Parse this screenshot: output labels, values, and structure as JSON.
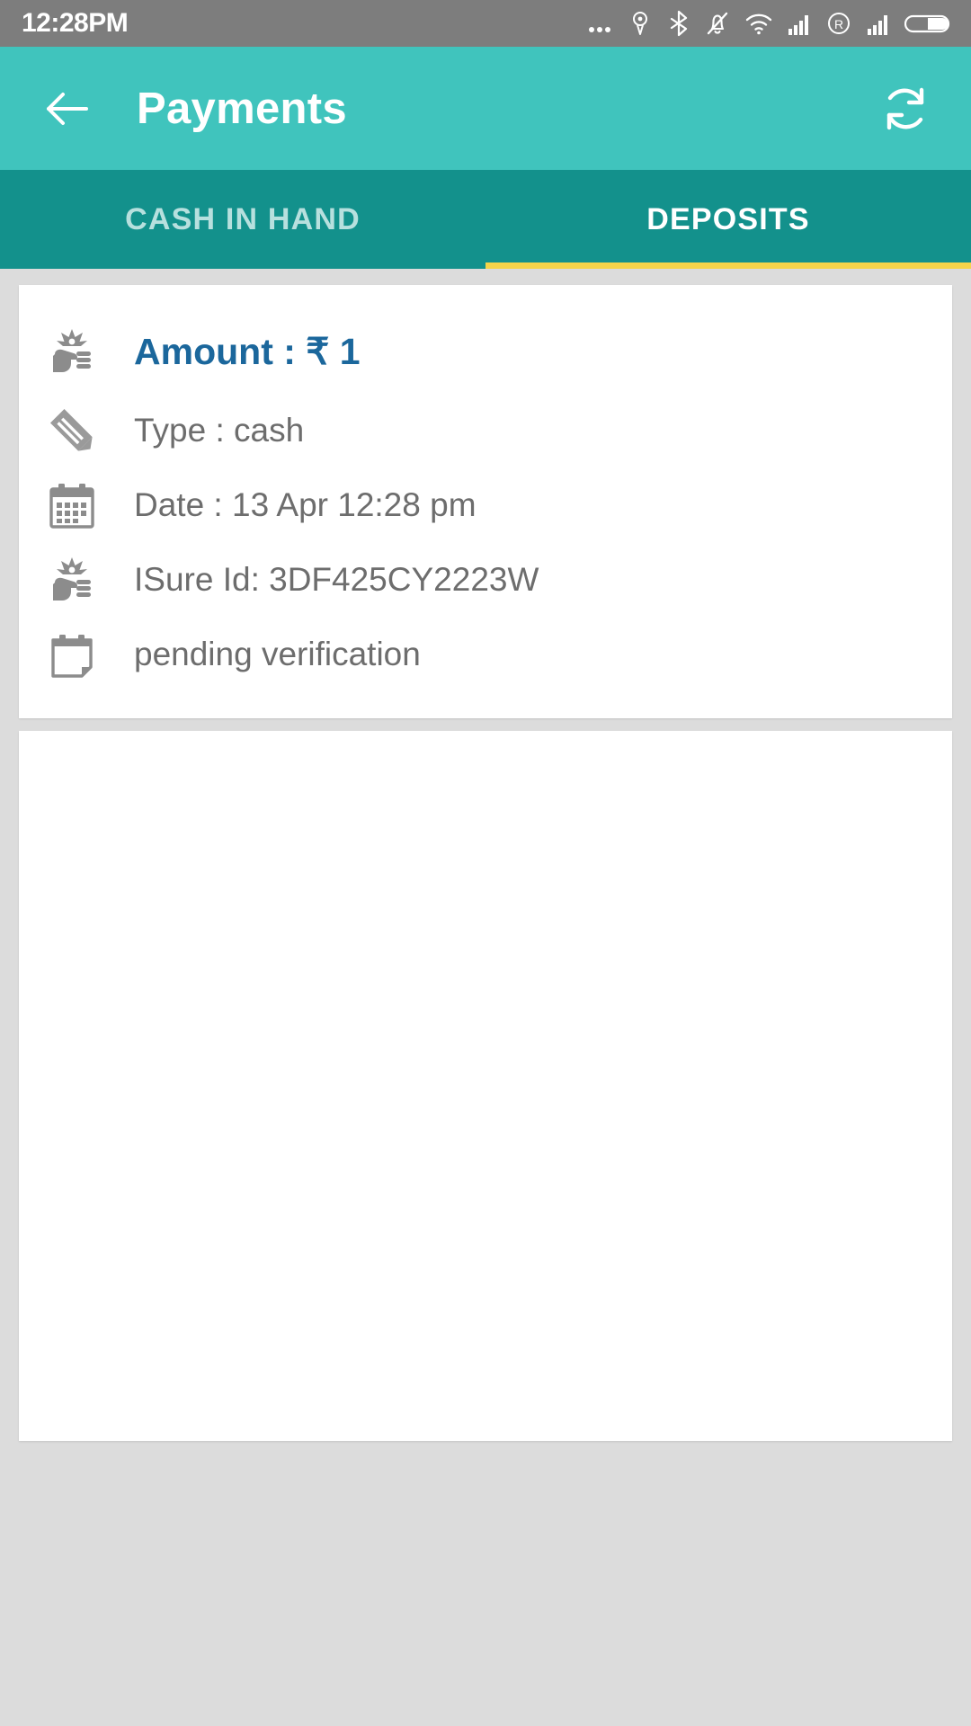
{
  "status_bar": {
    "time": "12:28PM",
    "icons": [
      {
        "name": "more-dots-icon"
      },
      {
        "name": "cast-icon"
      },
      {
        "name": "bluetooth-icon"
      },
      {
        "name": "mute-vibrate-icon"
      },
      {
        "name": "wifi-icon"
      },
      {
        "name": "signal-bars-icon"
      },
      {
        "name": "roaming-icon"
      },
      {
        "name": "signal-bars-2-icon"
      },
      {
        "name": "battery-icon"
      }
    ]
  },
  "app_bar": {
    "back_label": "back-arrow",
    "title": "Payments",
    "refresh_label": "refresh"
  },
  "tabs": {
    "items": [
      {
        "label": "CASH IN HAND",
        "active": false
      },
      {
        "label": "DEPOSITS",
        "active": true
      }
    ],
    "indicator_color": "#f5d44a"
  },
  "deposit_card": {
    "rows": [
      {
        "icon": "cash-in-hand-icon",
        "text": "Amount : ₹ 1",
        "emphasis": true
      },
      {
        "icon": "pencil-icon",
        "text": "Type : cash",
        "emphasis": false
      },
      {
        "icon": "calendar-icon",
        "text": "Date : 13 Apr 12:28 pm",
        "emphasis": false
      },
      {
        "icon": "cash-in-hand-icon",
        "text": "ISure Id: 3DF425CY2223W",
        "emphasis": false
      },
      {
        "icon": "empty-note-icon",
        "text": "pending verification",
        "emphasis": false
      }
    ]
  },
  "colors": {
    "appbar": "#40c4bd",
    "tabbar": "#13918c",
    "accent_yellow": "#f5d44a",
    "amount_blue": "#1b679c",
    "body_text": "#6d6d6d",
    "page_background": "#dcdcdc",
    "status_bar": "#7d7d7d"
  }
}
